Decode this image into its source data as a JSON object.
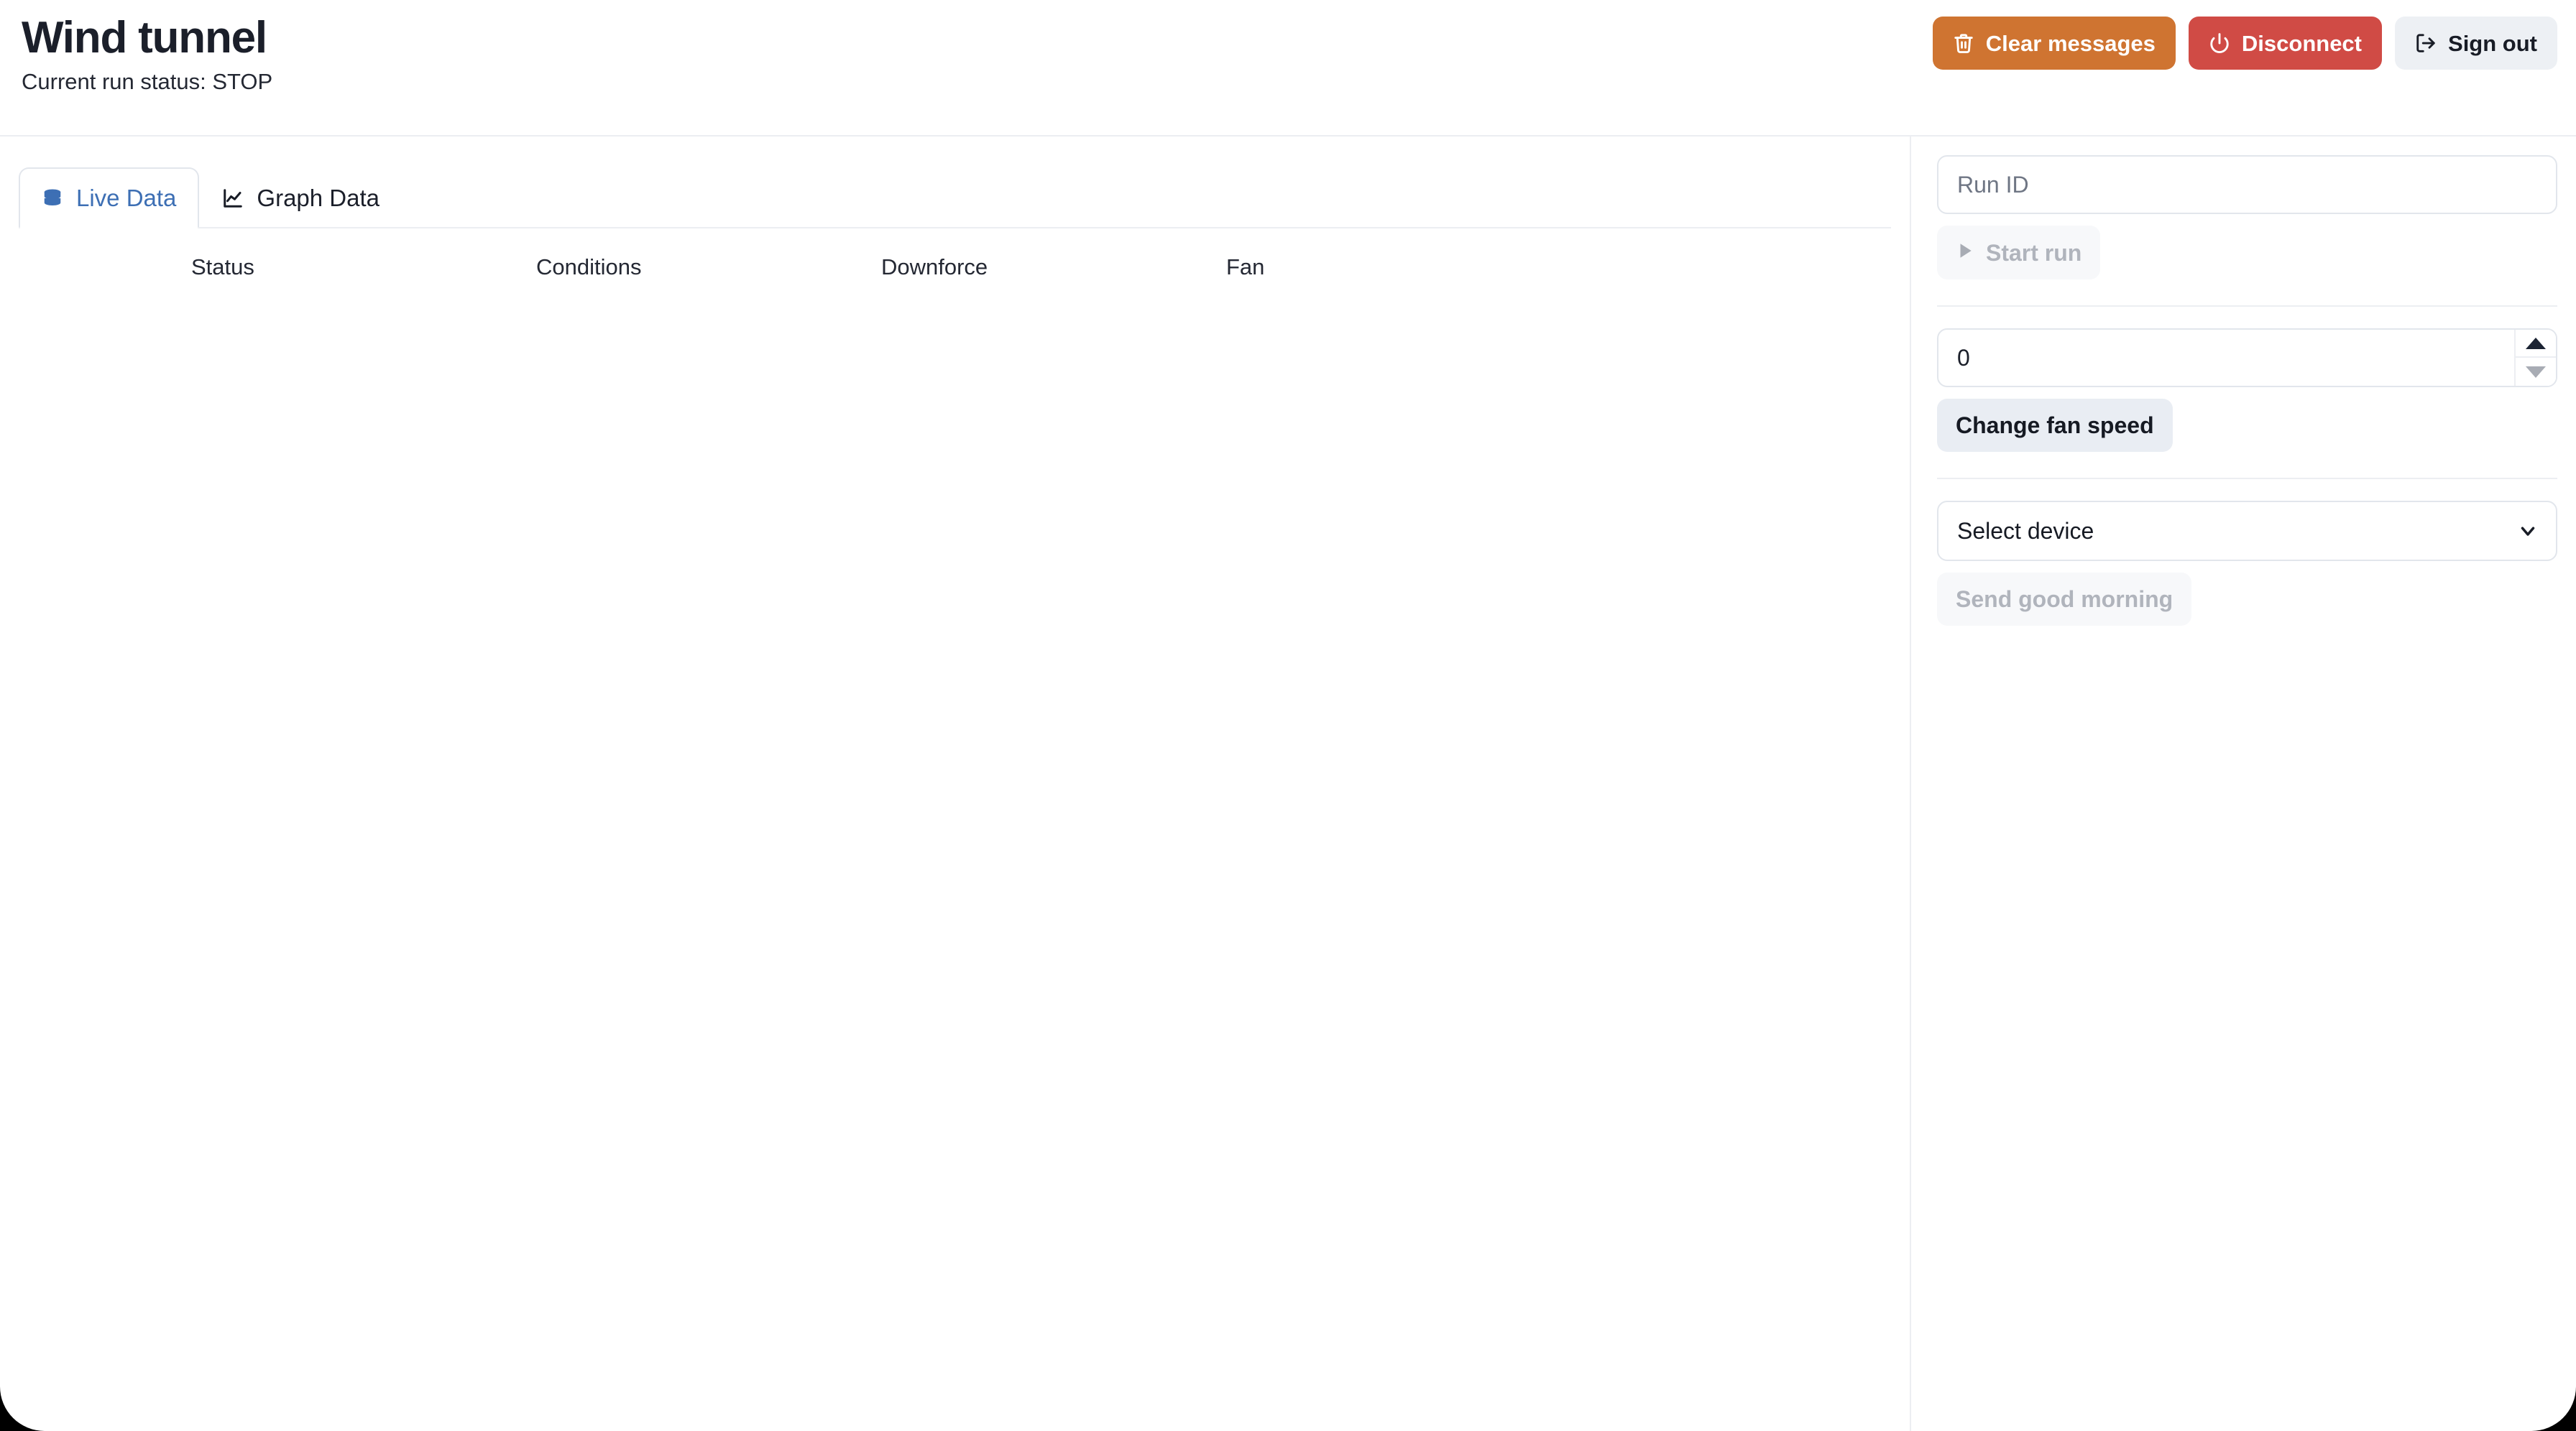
{
  "header": {
    "title": "Wind tunnel",
    "run_status": "Current run status: STOP",
    "actions": [
      {
        "label": "Clear messages",
        "icon": "trash-icon",
        "color": "#cf7431"
      },
      {
        "label": "Disconnect",
        "icon": "power-icon",
        "color": "#d04b45"
      },
      {
        "label": "Sign out",
        "icon": "logout-icon",
        "color": "#edf0f4"
      }
    ]
  },
  "tabs": [
    {
      "label": "Live Data",
      "icon": "database-icon",
      "active": true
    },
    {
      "label": "Graph Data",
      "icon": "line-chart-icon",
      "active": false
    }
  ],
  "table": {
    "columns": [
      "Status",
      "Conditions",
      "Downforce",
      "Fan"
    ],
    "rows": []
  },
  "sidebar": {
    "run_id": {
      "value": "",
      "placeholder": "Run ID"
    },
    "start_run": {
      "label": "Start run",
      "icon": "play-icon",
      "disabled": true
    },
    "fan_speed": {
      "value": "0",
      "placeholder": ""
    },
    "change_fan_speed": {
      "label": "Change fan speed",
      "disabled": false
    },
    "device_select": {
      "selected": "Select device",
      "icon": "chevron-down-icon"
    },
    "send_good_morning": {
      "label": "Send good morning",
      "disabled": true
    }
  },
  "colors": {
    "accent_blue": "#3d6fb4",
    "orange": "#cf7431",
    "red": "#d04b45",
    "neutral": "#edf0f4",
    "text": "#1b1f2a",
    "border": "#e2e6ec"
  }
}
